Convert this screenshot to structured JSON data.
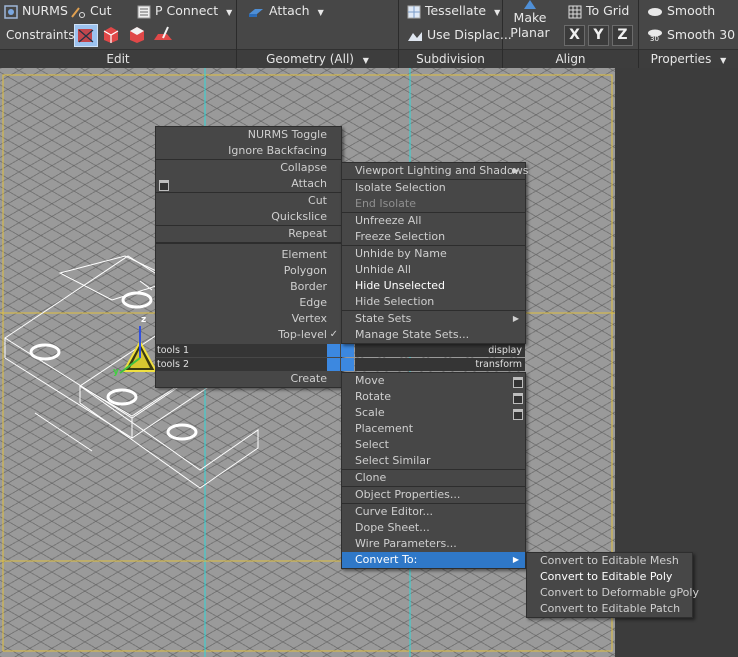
{
  "ribbon": {
    "edit": {
      "nurms_label": "NURMS",
      "cut_label": "Cut",
      "p_connect_label": "P Connect",
      "constraints_label": "Constraints:",
      "footer": "Edit"
    },
    "geometry": {
      "attach_label": "Attach",
      "footer": "Geometry (All)"
    },
    "subdivision": {
      "tessellate_label": "Tessellate",
      "use_displace_label": "Use Displac...",
      "footer": "Subdivision"
    },
    "align": {
      "make_planar_line1": "Make",
      "make_planar_line2": "Planar",
      "to_grid_label": "To Grid",
      "x_label": "X",
      "y_label": "Y",
      "z_label": "Z",
      "footer": "Align"
    },
    "properties": {
      "smooth_label": "Smooth",
      "smooth30_label": "Smooth 30",
      "smooth30_icon_text": "30",
      "footer": "Properties"
    }
  },
  "viewport": {
    "gizmo_z": "z",
    "gizmo_y": "y"
  },
  "menu_tools": {
    "items": [
      "NURMS Toggle",
      "Ignore Backfacing",
      "Collapse",
      "Attach",
      "Cut",
      "Quickslice",
      "Repeat",
      "Element",
      "Polygon",
      "Border",
      "Edge",
      "Vertex",
      "Top-level",
      "Create"
    ],
    "tools1_label": "tools 1",
    "tools2_label": "tools 2"
  },
  "menu_display": {
    "items": [
      "Viewport Lighting and Shadows",
      "Isolate Selection",
      "End Isolate",
      "Unfreeze All",
      "Freeze Selection",
      "Unhide by Name",
      "Unhide All",
      "Hide Unselected",
      "Hide Selection",
      "State Sets",
      "Manage State Sets..."
    ],
    "display_label": "display",
    "transform_label": "transform"
  },
  "menu_transform": {
    "items": [
      "Move",
      "Rotate",
      "Scale",
      "Placement",
      "Select",
      "Select Similar",
      "Clone",
      "Object Properties...",
      "Curve Editor...",
      "Dope Sheet...",
      "Wire Parameters...",
      "Convert To:"
    ]
  },
  "submenu_convert": {
    "items": [
      "Convert to Editable Mesh",
      "Convert to Editable Poly",
      "Convert to Deformable gPoly",
      "Convert to Editable Patch"
    ]
  },
  "colors": {
    "highlight": "#2f78c8",
    "viewport_bg": "#9a9a9a",
    "ribbon_bg": "#474747",
    "viewport_border": "#e0c040",
    "axis_line": "#30d8d8"
  },
  "icons": [
    "nurms-icon",
    "cut-icon",
    "p-connect-icon",
    "attach-icon",
    "tessellate-icon",
    "use-displace-icon",
    "make-planar-icon",
    "to-grid-icon",
    "smooth-icon",
    "smooth30-icon",
    "constraint-none-icon",
    "constraint-edge-icon",
    "constraint-face-icon",
    "constraint-normal-icon",
    "dropdown-arrow-icon",
    "submenu-arrow-icon",
    "checkmark-icon",
    "option-box-icon"
  ]
}
